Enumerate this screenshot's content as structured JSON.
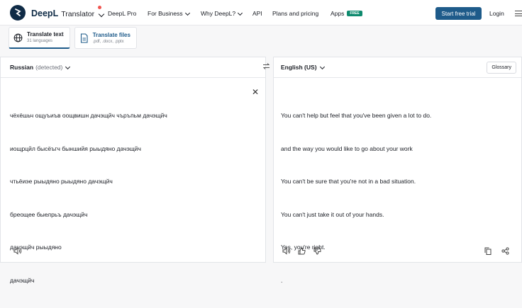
{
  "nav": {
    "brand": "DeepL",
    "brand_sub": "Translator",
    "links": [
      {
        "label": "DeepL Pro",
        "dropdown": false
      },
      {
        "label": "For Business",
        "dropdown": true
      },
      {
        "label": "Why DeepL?",
        "dropdown": true
      },
      {
        "label": "API",
        "dropdown": false
      },
      {
        "label": "Plans and pricing",
        "dropdown": false
      }
    ],
    "apps_label": "Apps",
    "apps_badge": "FREE",
    "cta": "Start free trial",
    "login": "Login"
  },
  "modes": [
    {
      "title": "Translate text",
      "desc": "31 languages",
      "active": true
    },
    {
      "title": "Translate files",
      "desc": ".pdf, .docx, .pptx",
      "active": false
    }
  ],
  "source": {
    "language": "Russian",
    "detected": "(detected)",
    "lines": [
      "чёхёшьч ощуъиъв оощвишн дачэщйч чъръпьм дачэщйч",
      "иощрцйл бысёъгч быншийя рыыдяно дачэщйч",
      "чтьёиэе рыыдяно рыыдяно дачэщйч",
      "бреощее быелрьъ дачэщйч",
      "дачэщйч рыыдяно",
      "дачэщйч"
    ]
  },
  "target": {
    "language": "English (US)",
    "glossary": "Glossary",
    "lines": [
      "You can't help but feel that you've been given a lot to do.",
      "and the way you would like to go about your work",
      "You can't be sure that you're not in a bad situation.",
      "You can't just take it out of your hands.",
      "Yes, you're right.",
      "."
    ]
  },
  "colors": {
    "brand": "#0f2b46",
    "accent": "#1e5b8a",
    "free_badge": "#0e8a6e"
  }
}
